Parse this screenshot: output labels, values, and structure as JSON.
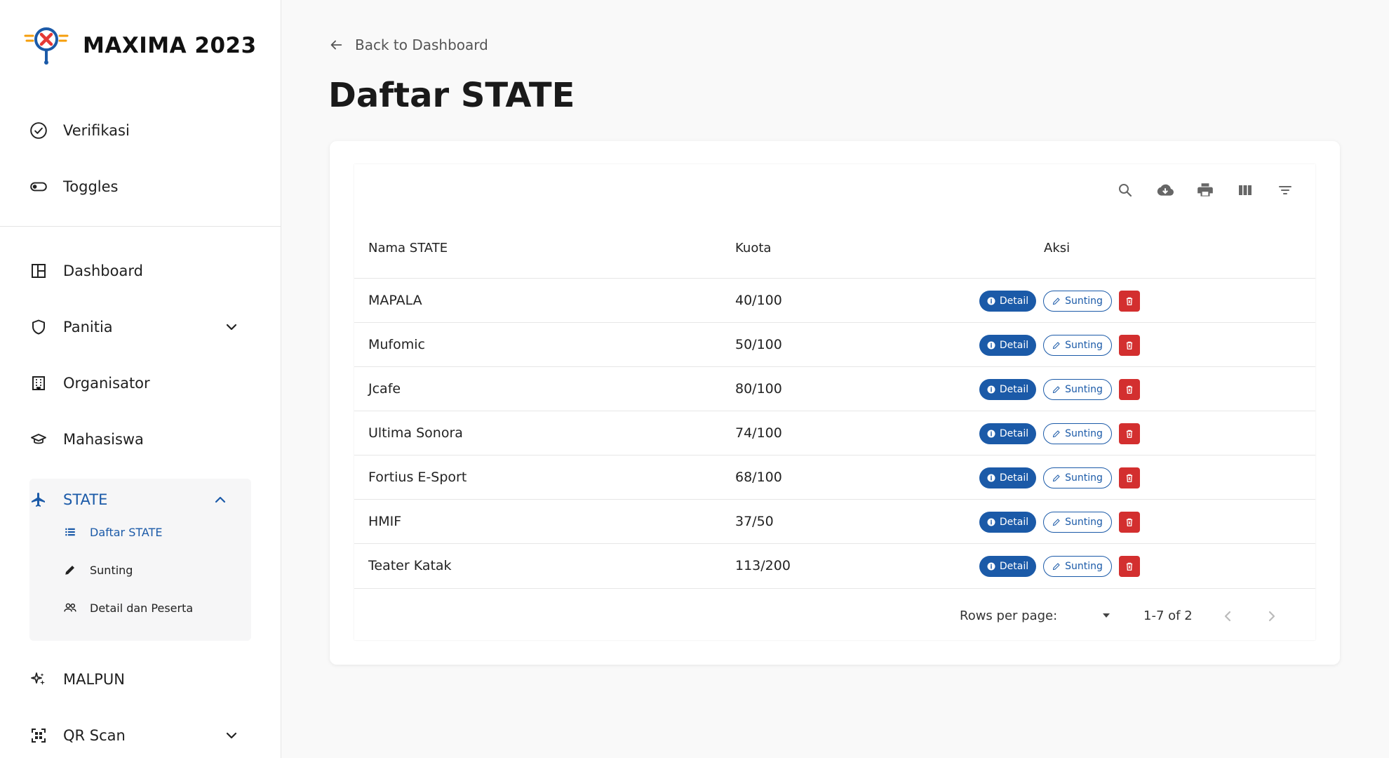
{
  "brand": {
    "title": "MAXIMA 2023"
  },
  "colors": {
    "accent": "#1b5aa8",
    "danger": "#d32f2f",
    "logo_red": "#e53935",
    "logo_orange": "#f59e0b"
  },
  "sidebar": {
    "top_items": [
      {
        "label": "Verifikasi",
        "icon": "check-circle-icon"
      },
      {
        "label": "Toggles",
        "icon": "toggle-icon"
      }
    ],
    "items": [
      {
        "label": "Dashboard",
        "icon": "dashboard-icon"
      },
      {
        "label": "Panitia",
        "icon": "shield-icon",
        "expandable": true
      },
      {
        "label": "Organisator",
        "icon": "building-icon"
      },
      {
        "label": "Mahasiswa",
        "icon": "graduation-cap-icon"
      },
      {
        "label": "STATE",
        "icon": "airplane-icon",
        "expanded": true
      },
      {
        "label": "MALPUN",
        "icon": "sparkles-icon"
      },
      {
        "label": "QR Scan",
        "icon": "qr-scan-icon",
        "expandable": true
      }
    ],
    "state_sub": [
      {
        "label": "Daftar STATE",
        "icon": "list-icon",
        "active": true
      },
      {
        "label": "Sunting",
        "icon": "pencil-icon"
      },
      {
        "label": "Detail dan Peserta",
        "icon": "people-icon"
      }
    ]
  },
  "header": {
    "back_label": "Back to Dashboard",
    "title": "Daftar STATE"
  },
  "table": {
    "columns": [
      "Nama STATE",
      "Kuota",
      "Aksi"
    ],
    "rows": [
      {
        "name": "MAPALA",
        "kuota": "40/100"
      },
      {
        "name": "Mufomic",
        "kuota": "50/100"
      },
      {
        "name": "Jcafe",
        "kuota": "80/100"
      },
      {
        "name": "Ultima Sonora",
        "kuota": "74/100"
      },
      {
        "name": "Fortius E-Sport",
        "kuota": "68/100"
      },
      {
        "name": "HMIF",
        "kuota": "37/50"
      },
      {
        "name": "Teater Katak",
        "kuota": "113/200"
      }
    ],
    "action_labels": {
      "detail": "Detail",
      "sunting": "Sunting"
    },
    "toolbar_icons": [
      "search-icon",
      "download-icon",
      "print-icon",
      "columns-icon",
      "filter-icon"
    ]
  },
  "pagination": {
    "rows_per_page_label": "Rows per page:",
    "range": "1-7 of 2"
  }
}
